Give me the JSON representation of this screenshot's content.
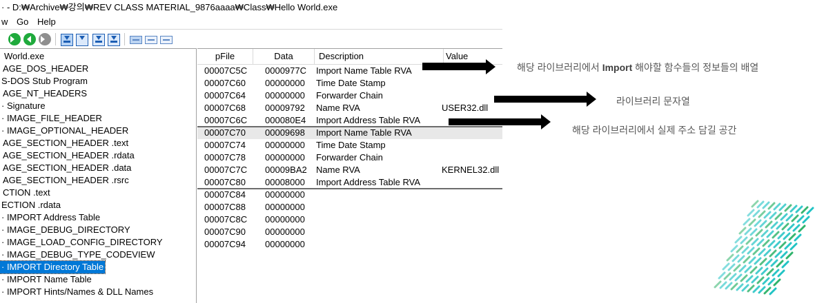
{
  "window": {
    "title": "· - D:₩Archive₩강의₩REV CLASS MATERIAL_9876aaaa₩Class₩Hello World.exe"
  },
  "menu": [
    "w",
    "Go",
    "Help"
  ],
  "toolbar": {
    "icons": [
      "forward-green-icon",
      "back-green-icon",
      "forward-gray-icon",
      "import-addr-icon",
      "export-icon",
      "import-dir-icon",
      "save-icon",
      "view-bytes-icon",
      "view-word-icon",
      "view-dword-icon"
    ]
  },
  "tree": {
    "items": [
      "World.exe",
      "AGE_DOS_HEADER",
      "S-DOS Stub Program",
      "AGE_NT_HEADERS",
      "· Signature",
      "· IMAGE_FILE_HEADER",
      "· IMAGE_OPTIONAL_HEADER",
      "AGE_SECTION_HEADER .text",
      "AGE_SECTION_HEADER .rdata",
      "AGE_SECTION_HEADER .data",
      "AGE_SECTION_HEADER .rsrc",
      "CTION .text",
      "ECTION .rdata",
      "· IMPORT Address Table",
      "· IMAGE_DEBUG_DIRECTORY",
      "· IMAGE_LOAD_CONFIG_DIRECTORY",
      "· IMAGE_DEBUG_TYPE_CODEVIEW",
      "· IMPORT Directory Table",
      "· IMPORT Name Table",
      "· IMPORT Hints/Names & DLL Names"
    ],
    "selected_index": 17
  },
  "list": {
    "headers": [
      "pFile",
      "Data",
      "Description",
      "Value"
    ],
    "rows": [
      [
        "00007C5C",
        "0000977C",
        "Import Name Table RVA",
        ""
      ],
      [
        "00007C60",
        "00000000",
        "Time Date Stamp",
        ""
      ],
      [
        "00007C64",
        "00000000",
        "Forwarder Chain",
        ""
      ],
      [
        "00007C68",
        "00009792",
        "Name RVA",
        "USER32.dll"
      ],
      [
        "00007C6C",
        "000080E4",
        "Import Address Table RVA",
        ""
      ],
      [
        "00007C70",
        "00009698",
        "Import Name Table RVA",
        ""
      ],
      [
        "00007C74",
        "00000000",
        "Time Date Stamp",
        ""
      ],
      [
        "00007C78",
        "00000000",
        "Forwarder Chain",
        ""
      ],
      [
        "00007C7C",
        "00009BA2",
        "Name RVA",
        "KERNEL32.dll"
      ],
      [
        "00007C80",
        "00008000",
        "Import Address Table RVA",
        ""
      ],
      [
        "00007C84",
        "00000000",
        "",
        ""
      ],
      [
        "00007C88",
        "00000000",
        "",
        ""
      ],
      [
        "00007C8C",
        "00000000",
        "",
        ""
      ],
      [
        "00007C90",
        "00000000",
        "",
        ""
      ],
      [
        "00007C94",
        "00000000",
        "",
        ""
      ]
    ],
    "highlight_row": 5,
    "group_breaks_before": [
      5,
      10
    ]
  },
  "annotations": {
    "a1_pre": "해당 라이브러리에서 ",
    "a1_bold": "Import",
    "a1_post": " 해야할 함수들의 정보들의 배열",
    "a2": "라이브러리 문자열",
    "a3": "해당 라이브러리에서 실제 주소 담길 공간"
  },
  "colors": {
    "selection": "#0078d7",
    "row_highlight": "#e8e8e8",
    "annotation_text": "#595959",
    "decoration_cyan": "#21c3c4",
    "decoration_green": "#2fb36b"
  }
}
